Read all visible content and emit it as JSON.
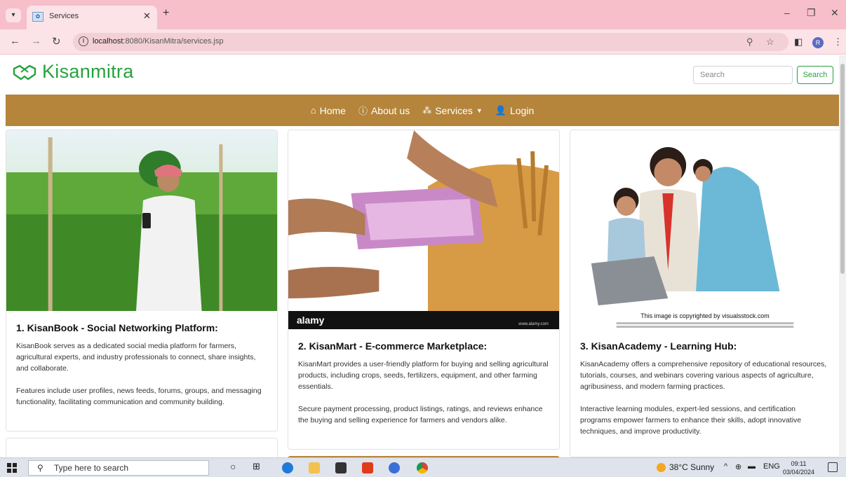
{
  "browser": {
    "tab_title": "Services",
    "url_host": "localhost",
    "url_path": ":8080/KisanMitra/services.jsp",
    "profile_initial": "R"
  },
  "site": {
    "brand_name": "Kisanmitra",
    "brand_color": "#27a23f",
    "search_placeholder": "Search",
    "search_button": "Search",
    "nav_color": "#b5853c",
    "nav": [
      {
        "label": "Home",
        "icon": "home-icon"
      },
      {
        "label": "About us",
        "icon": "info-icon"
      },
      {
        "label": "Services",
        "icon": "spinner-icon"
      },
      {
        "label": "Login",
        "icon": "user-plus-icon"
      }
    ]
  },
  "cards": [
    {
      "number": "1. KisanBook",
      "subtitle": " - Social Networking Platform:",
      "paragraphs": [
        "KisanBook serves as a dedicated social media platform for farmers, agricultural experts, and industry professionals to connect, share insights, and collaborate.",
        "Features include user profiles, news feeds, forums, groups, and messaging functionality, facilitating communication and community building."
      ]
    },
    {
      "number": "2. KisanMart",
      "subtitle": " - E-commerce Marketplace:",
      "image_brand": "alamy",
      "image_brand_url": "www.alamy.com",
      "paragraphs": [
        "KisanMart provides a user-friendly platform for buying and selling agricultural products, including crops, seeds, fertilizers, equipment, and other farming essentials.",
        "Secure payment processing, product listings, ratings, and reviews enhance the buying and selling experience for farmers and vendors alike."
      ]
    },
    {
      "number": "3. KisanAcademy",
      "subtitle": " - Learning Hub:",
      "image_caption": "This image is copyrighted by visualsstock.com",
      "paragraphs": [
        "KisanAcademy offers a comprehensive repository of educational resources, tutorials, courses, and webinars covering various aspects of agriculture, agribusiness, and modern farming practices.",
        "Interactive learning modules, expert-led sessions, and certification programs empower farmers to enhance their skills, adopt innovative techniques, and improve productivity."
      ]
    }
  ],
  "taskbar": {
    "search_placeholder": "Type here to search",
    "weather": "38°C  Sunny",
    "language": "ENG",
    "time": "09:11",
    "date": "03/04/2024"
  }
}
